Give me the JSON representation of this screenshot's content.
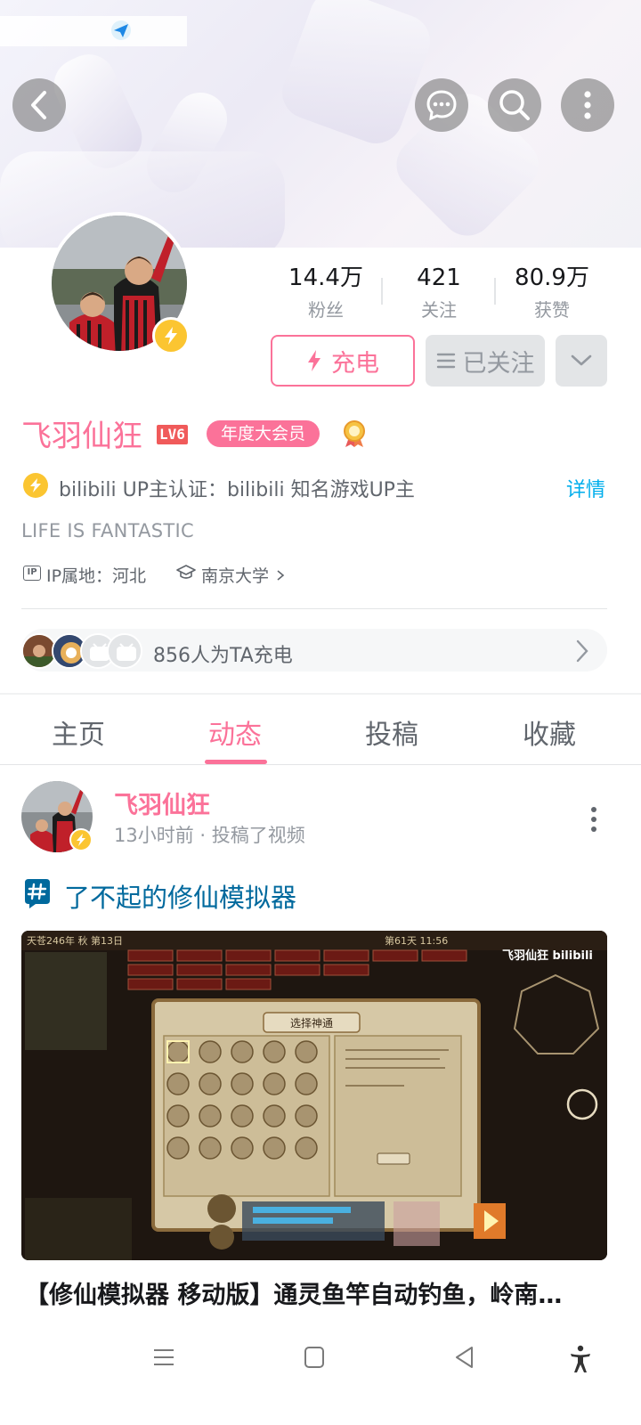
{
  "header": {
    "back_icon": "chevron-left-icon",
    "message_icon": "message-icon",
    "search_icon": "search-icon",
    "more_icon": "more-vertical-icon"
  },
  "profile": {
    "stats": [
      {
        "value": "14.4万",
        "label": "粉丝"
      },
      {
        "value": "421",
        "label": "关注"
      },
      {
        "value": "80.9万",
        "label": "获赞"
      }
    ],
    "charge_label": "充电",
    "follow_label": "已关注",
    "name": "飞羽仙狂",
    "level": "LV6",
    "vip_badge": "年度大会员",
    "certification": "bilibili UP主认证：bilibili 知名游戏UP主",
    "certification_detail": "详情",
    "signature": "LIFE IS FANTASTIC",
    "ip_icon_text": "IP",
    "ip_location": "IP属地：河北",
    "school": "南京大学",
    "charge_count_text": "856人为TA充电"
  },
  "tabs": [
    {
      "label": "主页"
    },
    {
      "label": "动态"
    },
    {
      "label": "投稿"
    },
    {
      "label": "收藏"
    }
  ],
  "post": {
    "author": "飞羽仙狂",
    "meta": "13小时前 · 投稿了视频",
    "topic": "了不起的修仙模拟器",
    "video_title": "【修仙模拟器 移动版】通灵鱼竿自动钓鱼，岭南…",
    "thumbnail": {
      "top_left": "天苍246年 秋 第13日",
      "top_center": "第61天 11:56",
      "dialog_title": "选择神通",
      "watermark": "飞羽仙狂 bilibili"
    }
  },
  "colors": {
    "accent": "#fb7299",
    "link": "#00aeec",
    "topic": "#00699d",
    "gold": "#fbc531"
  }
}
